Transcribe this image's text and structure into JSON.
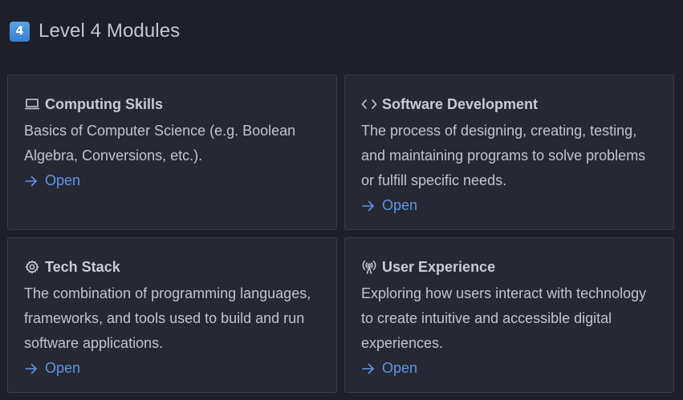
{
  "header": {
    "badge_glyph": "4",
    "title": "Level 4 Modules",
    "badge_color": "#4a90e2"
  },
  "modules": [
    {
      "icon": "laptop-icon",
      "title": "Computing Skills",
      "description": "Basics of Computer Science (e.g. Boolean Algebra, Conversions, etc.).",
      "link_label": "Open"
    },
    {
      "icon": "code-brackets-icon",
      "title": "Software Development",
      "description": "The process of designing, creating, testing, and maintaining programs to solve problems or fulfill specific needs.",
      "link_label": "Open"
    },
    {
      "icon": "gear-icon",
      "title": "Tech Stack",
      "description": "The combination of programming languages, frameworks, and tools used to build and run software applications.",
      "link_label": "Open"
    },
    {
      "icon": "broadcast-icon",
      "title": "User Experience",
      "description": "Exploring how users interact with technology to create intuitive and accessible digital experiences.",
      "link_label": "Open"
    }
  ],
  "colors": {
    "background": "#1e1f29",
    "card": "#262833",
    "card_border": "#3a3d4a",
    "link": "#5f95e6",
    "text": "#c9ccd6"
  }
}
